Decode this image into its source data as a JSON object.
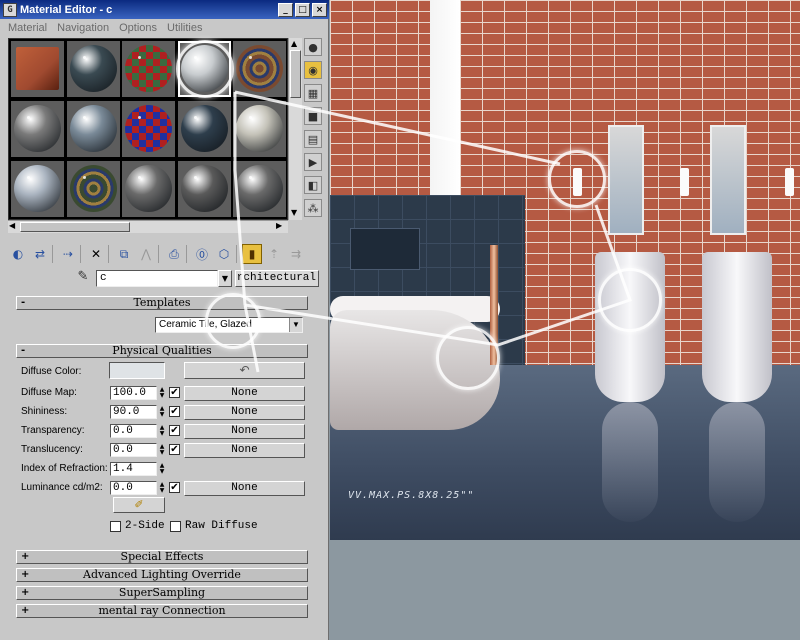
{
  "window": {
    "title": "Material Editor - c",
    "app_icon": "3ds-max-icon",
    "controls": [
      "_",
      "□",
      "×"
    ]
  },
  "menu": [
    "Material",
    "Navigation",
    "Options",
    "Utilities"
  ],
  "sample_slots": [
    {
      "kind": "cube",
      "color": "#a04a30"
    },
    {
      "kind": "sphere",
      "color": "#3a4a52"
    },
    {
      "kind": "sphere-checker",
      "color": "#3a6a40"
    },
    {
      "kind": "sphere",
      "color": "#c8cccf",
      "selected": true
    },
    {
      "kind": "sphere-swirl",
      "color": "#7a4a30"
    },
    {
      "kind": "sphere",
      "color": "#7a7a7a"
    },
    {
      "kind": "sphere",
      "color": "#7a8a98"
    },
    {
      "kind": "sphere-checker",
      "color": "#2030a0"
    },
    {
      "kind": "sphere",
      "color": "#2e3e4c"
    },
    {
      "kind": "sphere",
      "color": "#c4c2b8"
    },
    {
      "kind": "sphere",
      "color": "#aab4c0"
    },
    {
      "kind": "sphere-swirl",
      "color": "#3a4a30"
    },
    {
      "kind": "sphere",
      "color": "#6a6a6a"
    },
    {
      "kind": "sphere",
      "color": "#5a5a5a"
    },
    {
      "kind": "sphere",
      "color": "#6a6a6a"
    }
  ],
  "material_name": "c",
  "material_type": "rchitectural",
  "templates": {
    "header": "Templates",
    "selected": "Ceramic Tile, Glazed"
  },
  "physical": {
    "header": "Physical Qualities",
    "diffuse_color_label": "Diffuse Color:",
    "rows": [
      {
        "label": "Diffuse Map:",
        "value": "100.0",
        "checked": "✔",
        "map": "None"
      },
      {
        "label": "Shininess:",
        "value": "90.0",
        "checked": "✔",
        "map": "None"
      },
      {
        "label": "Transparency:",
        "value": "0.0",
        "checked": "✔",
        "map": "None"
      },
      {
        "label": "Translucency:",
        "value": "0.0",
        "checked": "✔",
        "map": "None"
      },
      {
        "label": "Index of Refraction:",
        "value": "1.4",
        "checked": "",
        "map": ""
      },
      {
        "label": "Luminance cd/m2:",
        "value": "0.0",
        "checked": "✔",
        "map": "None"
      }
    ],
    "two_side": "2-Side",
    "raw_diffuse": "Raw Diffuse"
  },
  "collapsed_rollouts": [
    "Special Effects",
    "Advanced Lighting Override",
    "SuperSampling",
    "mental ray Connection"
  ],
  "rollout_signs": {
    "open": "-",
    "closed": "+"
  },
  "render": {
    "watermark": "VV.MAX.PS.8X8.25\"\""
  }
}
